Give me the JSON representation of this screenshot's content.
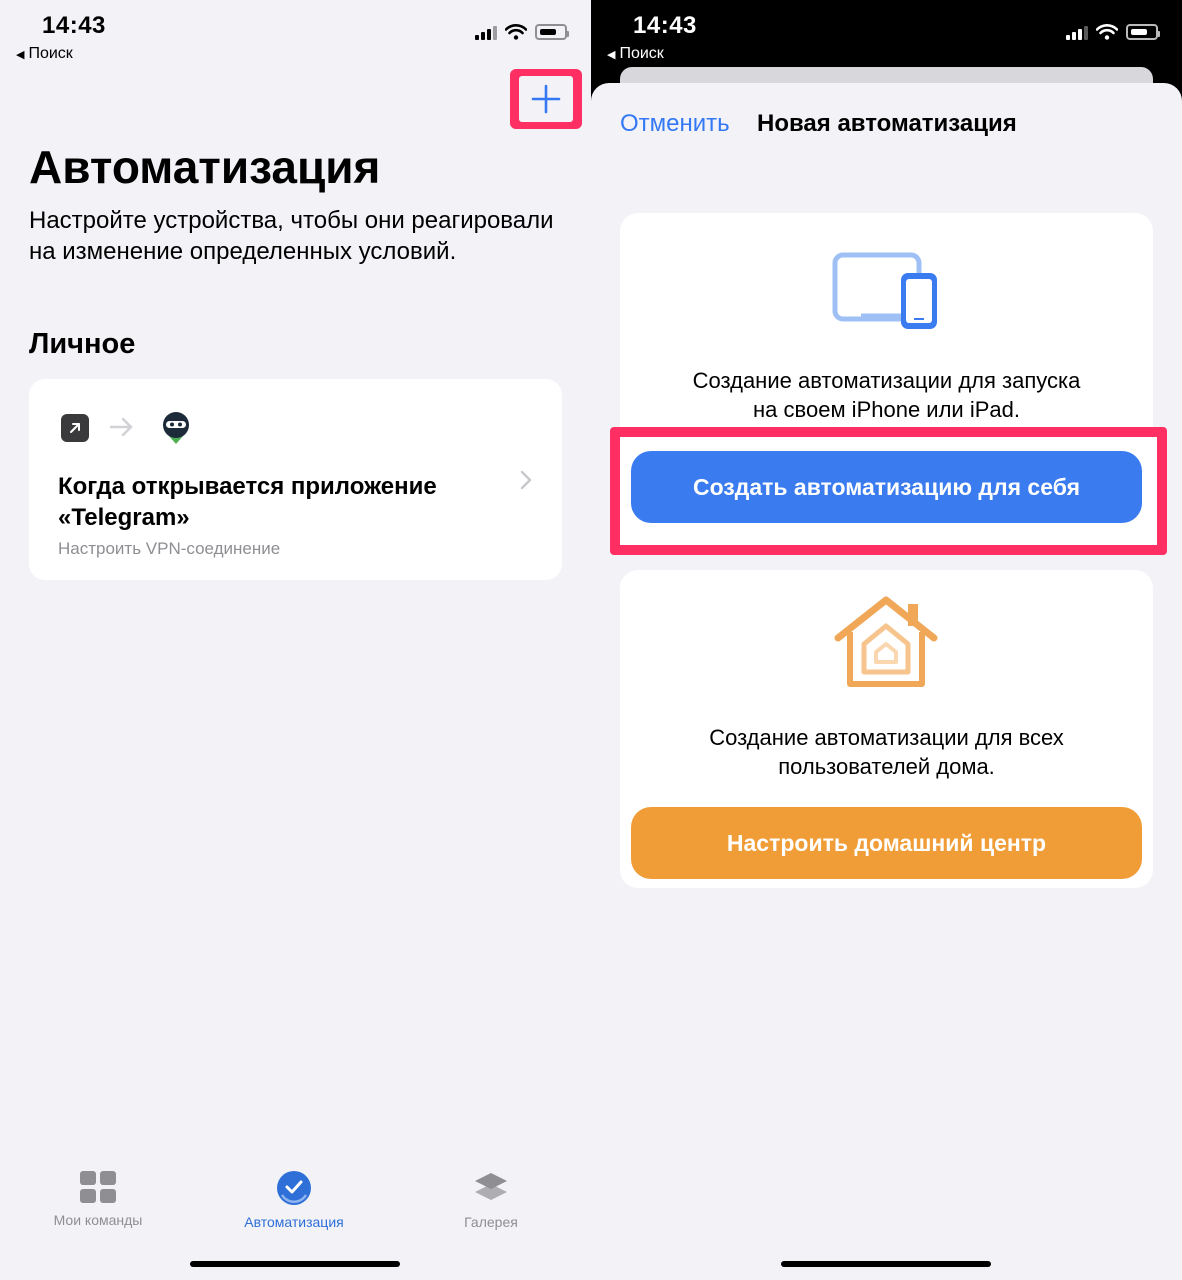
{
  "left": {
    "status": {
      "time": "14:43",
      "back": "Поиск"
    },
    "title": "Автоматизация",
    "subtitle": "Настройте устройства, чтобы они реагировали на изменение определенных условий.",
    "section": "Личное",
    "automation": {
      "title": "Когда открывается приложение «Telegram»",
      "subtitle": "Настроить VPN-соединение"
    },
    "tabs": [
      {
        "label": "Мои команды",
        "icon": "grid-icon"
      },
      {
        "label": "Автоматизация",
        "icon": "checkmark-circle-icon",
        "active": true
      },
      {
        "label": "Галерея",
        "icon": "layers-icon"
      }
    ]
  },
  "right": {
    "status": {
      "time": "14:43",
      "back": "Поиск"
    },
    "nav": {
      "cancel": "Отменить",
      "title": "Новая автоматизация"
    },
    "personal": {
      "description_line1": "Создание автоматизации для запуска",
      "description_line2": "на своем iPhone или iPad.",
      "button": "Создать автоматизацию для себя"
    },
    "home": {
      "description_line1": "Создание автоматизации для всех",
      "description_line2": "пользователей дома.",
      "button": "Настроить домашний центр"
    }
  },
  "colors": {
    "accent_blue": "#3478f6",
    "button_blue": "#3a7bf0",
    "button_orange": "#f09d38",
    "highlight_pink": "#ff2e63",
    "background": "#f2f2f7"
  }
}
